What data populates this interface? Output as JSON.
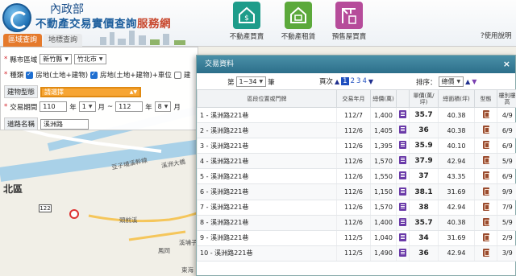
{
  "header": {
    "org": "內政部",
    "title_main": "不動產交易實價查詢",
    "title_accent": "服務網",
    "tabs": [
      "區域查詢",
      "地標查詢"
    ],
    "nav": [
      {
        "label": "不動產買賣",
        "icon": "dollar-house-icon",
        "color": "#1e9c8a"
      },
      {
        "label": "不動產租賃",
        "icon": "rent-house-icon",
        "color": "#5ca93b"
      },
      {
        "label": "預售屋買賣",
        "icon": "crane-icon",
        "color": "#b64c9a"
      }
    ],
    "help": "使用說明"
  },
  "form": {
    "county_label": "縣市區域",
    "county": "新竹縣",
    "town": "竹北市",
    "type_label": "種類",
    "types": [
      {
        "label": "房地(土地+建物)",
        "checked": true
      },
      {
        "label": "房地(土地+建物)+車位",
        "checked": true
      },
      {
        "label": "建",
        "checked": false
      }
    ],
    "building_label": "建物型態",
    "building_value": "請選擇",
    "period_label": "交易期間",
    "from_year": "110",
    "from_month": "1",
    "to_year": "112",
    "to_month": "8",
    "year_unit": "年",
    "month_unit": "月",
    "tilde": "~",
    "road_label": "道路名稱",
    "road_value": "溪洲路"
  },
  "map": {
    "district": "北區",
    "road_number": "122",
    "places": [
      "豆子埔溪幹線",
      "溪洲大橋",
      "頭前溪",
      "溪埔子",
      "鳳岡",
      "東海"
    ]
  },
  "dialog": {
    "title": "交易資料",
    "close": "×",
    "page_prefix": "第",
    "page_range": "1~34",
    "page_suffix": "筆",
    "page_label": "頁次",
    "pages": [
      "1",
      "2",
      "3",
      "4"
    ],
    "current_page": "1",
    "sort_label": "排序：",
    "sort_value": "總價",
    "columns": [
      "區段位置或門牌",
      "交易年月",
      "總價(萬)",
      "",
      "單價(萬/坪)",
      "總面積(坪)",
      "型態",
      "樓別樓高"
    ],
    "rows": [
      {
        "n": "1",
        "addr": "溪洲路221巷",
        "date": "112/7",
        "total": "1,400",
        "price": "35.7",
        "area": "40.38",
        "floor": "4/9"
      },
      {
        "n": "2",
        "addr": "溪洲路221巷",
        "date": "112/6",
        "total": "1,405",
        "price": "36",
        "area": "40.38",
        "floor": "6/9"
      },
      {
        "n": "3",
        "addr": "溪洲路221巷",
        "date": "112/6",
        "total": "1,395",
        "price": "35.9",
        "area": "40.10",
        "floor": "6/9"
      },
      {
        "n": "4",
        "addr": "溪洲路221巷",
        "date": "112/6",
        "total": "1,570",
        "price": "37.9",
        "area": "42.94",
        "floor": "5/9"
      },
      {
        "n": "5",
        "addr": "溪洲路221巷",
        "date": "112/6",
        "total": "1,550",
        "price": "37",
        "area": "43.35",
        "floor": "6/9"
      },
      {
        "n": "6",
        "addr": "溪洲路221巷",
        "date": "112/6",
        "total": "1,150",
        "price": "38.1",
        "area": "31.69",
        "floor": "9/9"
      },
      {
        "n": "7",
        "addr": "溪洲路221巷",
        "date": "112/6",
        "total": "1,570",
        "price": "38",
        "area": "42.94",
        "floor": "7/9"
      },
      {
        "n": "8",
        "addr": "溪洲路221巷",
        "date": "112/6",
        "total": "1,400",
        "price": "35.7",
        "area": "40.38",
        "floor": "5/9"
      },
      {
        "n": "9",
        "addr": "溪洲路221巷",
        "date": "112/5",
        "total": "1,040",
        "price": "34",
        "area": "31.69",
        "floor": "2/9"
      },
      {
        "n": "10",
        "addr": "溪洲路221巷",
        "date": "112/5",
        "total": "1,490",
        "price": "36",
        "area": "42.94",
        "floor": "3/9"
      }
    ]
  },
  "colors": {
    "accent_orange": "#e57a2c",
    "dialog_header": "#2c6f8a",
    "purple": "#6a3aa8",
    "brown": "#9a4b2e"
  }
}
